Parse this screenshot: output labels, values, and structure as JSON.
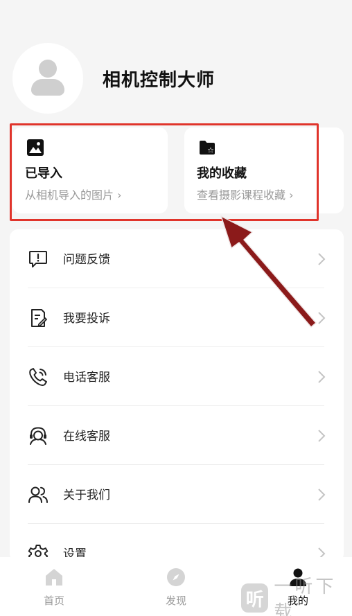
{
  "profile": {
    "username": "相机控制大师"
  },
  "cards": [
    {
      "title": "已导入",
      "subtitle": "从相机导入的图片",
      "icon": "image-icon"
    },
    {
      "title": "我的收藏",
      "subtitle": "查看摄影课程收藏",
      "icon": "folder-star-icon"
    }
  ],
  "menu": {
    "items": [
      {
        "label": "问题反馈",
        "icon": "feedback-icon"
      },
      {
        "label": "我要投诉",
        "icon": "complaint-icon"
      },
      {
        "label": "电话客服",
        "icon": "phone-icon"
      },
      {
        "label": "在线客服",
        "icon": "headset-icon"
      },
      {
        "label": "关于我们",
        "icon": "users-icon"
      },
      {
        "label": "设置",
        "icon": "settings-icon"
      }
    ]
  },
  "tabbar": {
    "tabs": [
      {
        "label": "首页",
        "icon": "home-icon"
      },
      {
        "label": "发现",
        "icon": "discover-icon"
      },
      {
        "label": "我的",
        "icon": "profile-icon",
        "active": true
      }
    ]
  },
  "watermark": {
    "logo": "听",
    "text": "一听下载"
  },
  "colors": {
    "highlight": "#e0342b",
    "arrow": "#8b1a1a",
    "muted_text": "#9a9a9a"
  }
}
